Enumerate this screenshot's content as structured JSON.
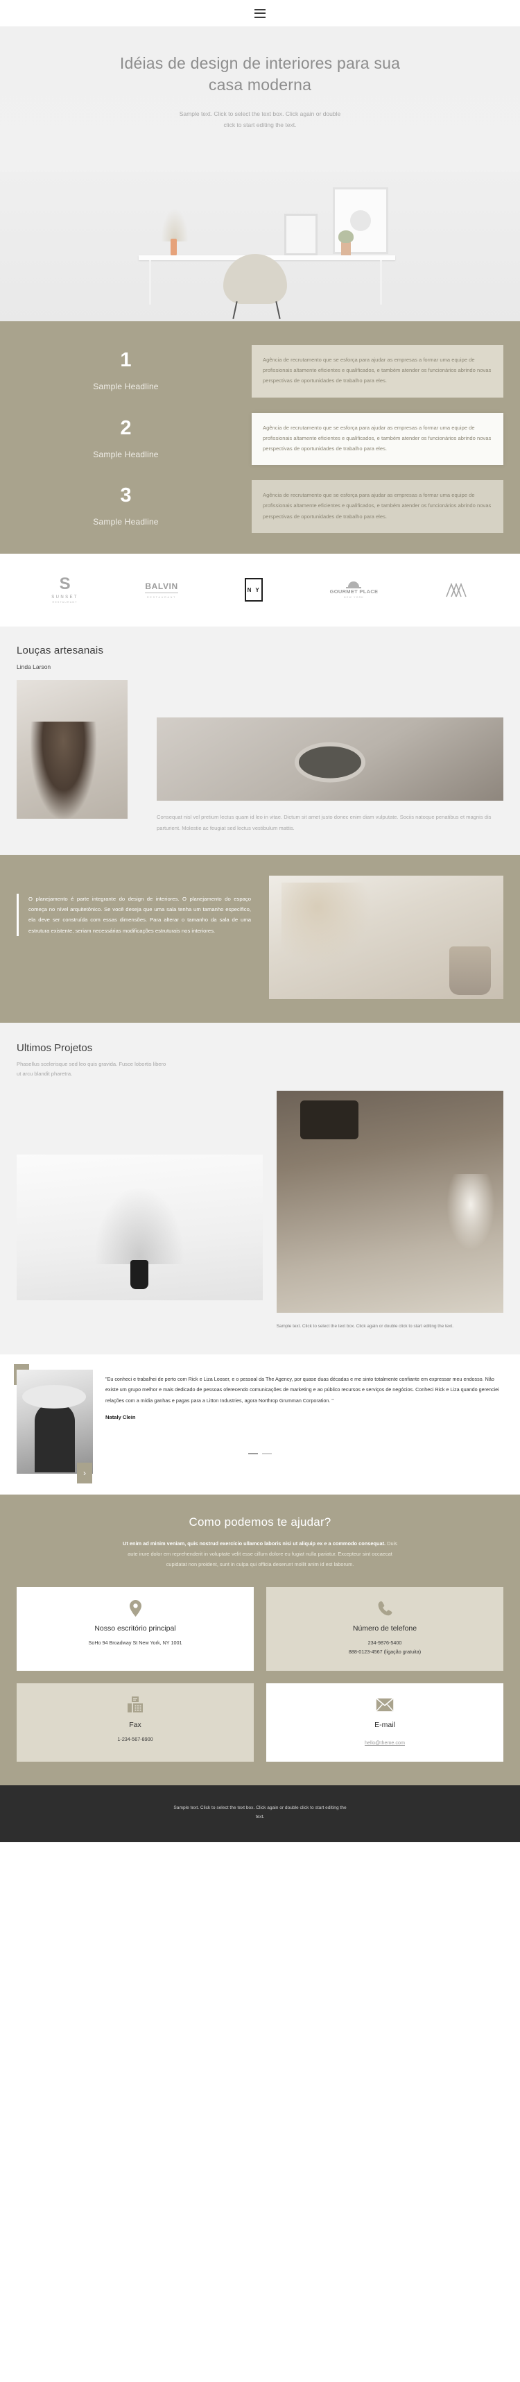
{
  "header": {
    "menu_icon": "hamburger-menu-icon"
  },
  "hero": {
    "title": "Idéias de design de interiores para sua casa moderna",
    "subtitle": "Sample text. Click to select the text box. Click again or double click to start editing the text."
  },
  "steps": [
    {
      "number": "1",
      "title": "Sample Headline",
      "body": "Agência de recrutamento que se esforça para ajudar as empresas a formar uma equipe de profissionais altamente eficientes e qualificados, e também atender os funcionários abrindo novas perspectivas de oportunidades de trabalho para eles."
    },
    {
      "number": "2",
      "title": "Sample Headline",
      "body": "Agência de recrutamento que se esforça para ajudar as empresas a formar uma equipe de profissionais altamente eficientes e qualificados, e também atender os funcionários abrindo novas perspectivas de oportunidades de trabalho para eles."
    },
    {
      "number": "3",
      "title": "Sample Headline",
      "body": "Agência de recrutamento que se esforça para ajudar as empresas a formar uma equipe de profissionais altamente eficientes e qualificados, e também atender os funcionários abrindo novas perspectivas de oportunidades de trabalho para eles."
    }
  ],
  "logos": [
    {
      "mark": "S",
      "name": "SUNSET",
      "sub": "RESTAURANT",
      "icon": "sunset-logo"
    },
    {
      "name": "BALVIN",
      "sub": "RESTAURANT",
      "icon": "balvin-logo"
    },
    {
      "name": "N Y",
      "icon": "ny-logo"
    },
    {
      "name": "GOURMET PLACE",
      "sub": "NEW YORK",
      "icon": "gourmet-place-logo"
    },
    {
      "name": "",
      "icon": "mountains-logo"
    }
  ],
  "ceramics": {
    "title": "Louças artesanais",
    "author": "Linda Larson",
    "paragraph": "Consequat nisl vel pretium lectus quam id leo in vitae. Dictum sit amet justo donec enim diam vulputate. Sociis natoque penatibus et magnis dis parturient. Molestie ac feugiat sed lectus vestibulum mattis.",
    "image_left": "woman-with-ceramics-photo",
    "image_right": "stacked-bowls-photo"
  },
  "planning": {
    "quote": "O planejamento é parte integrante do design de interiores. O planejamento do espaço começa no nível arquitetônico. Se você deseja que uma sala tenha um tamanho específico, ela deve ser construída com essas dimensões. Para alterar o tamanho da sala de uma estrutura existente, seriam necessárias modificações estruturais nos interiores.",
    "image": "pampas-grass-photo"
  },
  "projects": {
    "title": "Ultimos Projetos",
    "lead": "Phasellus scelerisque sed leo quis gravida. Fusce lobortis libero ut arcu blandit pharetra.",
    "caption": "Sample text. Click to select the text box. Click again or double click to start editing the text.",
    "image_left": "black-vase-photo",
    "image_right": "wooden-lamp-photo"
  },
  "testimonial": {
    "quote": "\"Eu conheci e trabalhei de perto com Rick e Liza Looser, e o pessoal da The Agency, por quase duas décadas e me sinto totalmente confiante em expressar meu endosso. Não existe um grupo melhor e mais dedicado de pessoas oferecendo comunicações de marketing e ao público recursos e serviços de negócios. Conheci Rick e Liza quando gerenciei relações com a mídia ganhas e pagas para a Litton Industries, agora Northrop Grumman Corporation. \"",
    "name": "Nataly Clein",
    "photo": "woman-in-hat-photo",
    "prev_label": "‹",
    "next_label": "›",
    "dots": 2,
    "active_dot": 1
  },
  "contact": {
    "title": "Como podemos te ajudar?",
    "blurb_bold": "Ut enim ad minim veniam, quis nostrud exercício ullamco laboris nisi ut aliquip ex e a commodo consequat.",
    "blurb_rest": " Duis aute irure dolor em reprehenderit in voluptate velit esse cillum dolore eu fugiat nulla pariatur. Excepteur sint occaecat cupidatat non proident, sunt in culpa qui officia deserunt mollit anim id est laborum.",
    "cards": [
      {
        "icon": "map-pin-icon",
        "title": "Nosso escritório principal",
        "line1": "SoHo 94 Broadway St New York, NY 1001",
        "line2": ""
      },
      {
        "icon": "phone-icon",
        "title": "Número de telefone",
        "line1": "234-9876-5400",
        "line2": "888-0123-4567 (ligação gratuita)"
      },
      {
        "icon": "fax-icon",
        "title": "Fax",
        "line1": "1-234-567-8900",
        "line2": ""
      },
      {
        "icon": "envelope-icon",
        "title": "E-mail",
        "line1": "hello@theme.com",
        "line2": ""
      }
    ]
  },
  "footer": {
    "text": "Sample text. Click to select the text box. Click again or double click to start editing the text."
  },
  "colors": {
    "tan": "#a9a38d",
    "cream": "#ddd9cb",
    "light_bg": "#f2f2f2",
    "footer_dark": "#2e2e2e"
  }
}
